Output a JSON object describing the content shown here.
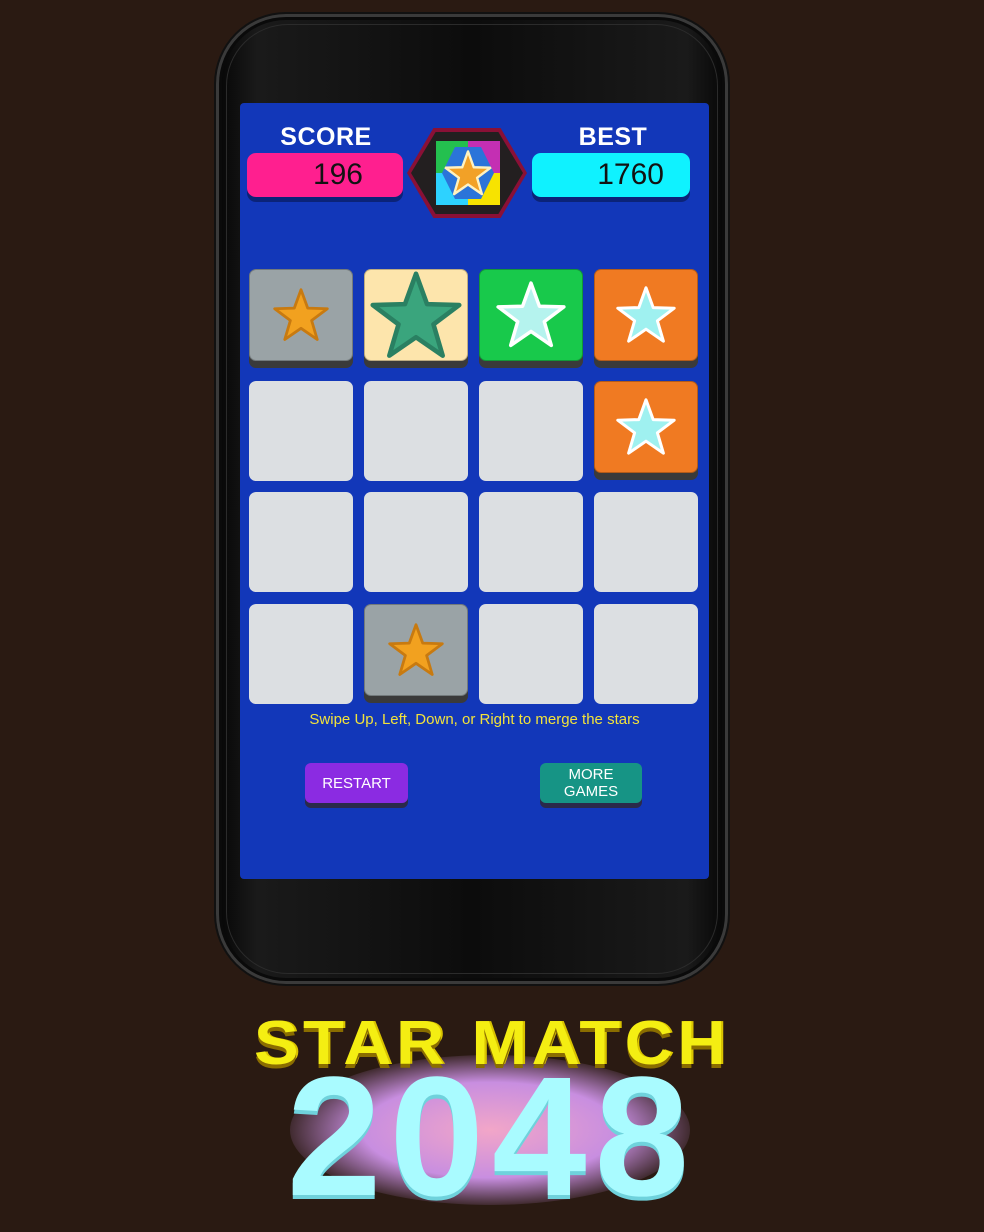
{
  "header": {
    "score_label": "SCORE",
    "score_value": "196",
    "best_label": "BEST",
    "best_value": "1760"
  },
  "board": {
    "rows": 4,
    "cols": 4,
    "tiles": [
      {
        "row": 0,
        "col": 0,
        "color": "gray",
        "star": "gold-star-icon"
      },
      {
        "row": 0,
        "col": 1,
        "color": "cream",
        "star": "green-star-icon"
      },
      {
        "row": 0,
        "col": 2,
        "color": "green",
        "star": "white-star-icon"
      },
      {
        "row": 0,
        "col": 3,
        "color": "orange",
        "star": "cyan-star-icon"
      },
      {
        "row": 1,
        "col": 3,
        "color": "orange",
        "star": "cyan-star-icon"
      },
      {
        "row": 3,
        "col": 1,
        "color": "gray",
        "star": "gold-star-icon"
      }
    ]
  },
  "hint": "Swipe Up, Left, Down, or Right to merge the stars",
  "buttons": {
    "restart": "RESTART",
    "more_games": "MORE\nGAMES"
  },
  "title": {
    "line1": "STAR MATCH",
    "line2": "2048"
  },
  "colors": {
    "screen": "#1237b9",
    "score_box": "#ff1f8f",
    "best_box": "#0ff2ff",
    "tile_gray": "#9aa3a6",
    "tile_cream": "#fde5ac",
    "tile_green": "#18c94b",
    "tile_orange": "#f07a22",
    "restart": "#8b2be2",
    "more_games": "#169485"
  }
}
